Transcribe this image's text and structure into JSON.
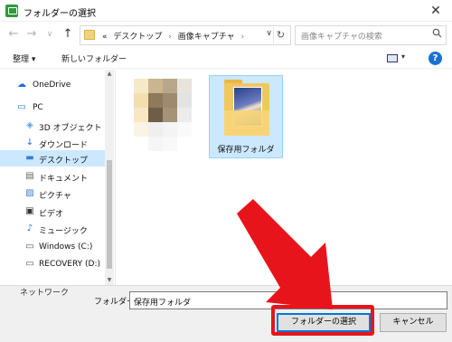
{
  "window": {
    "title": "フォルダーの選択",
    "close_glyph": "✕"
  },
  "nav": {
    "back_glyph": "←",
    "forward_glyph": "→",
    "dropdown_glyph": "∨",
    "up_glyph": "↑",
    "address": {
      "prefix": "«",
      "crumbs": [
        "デスクトップ",
        "画像キャプチャ"
      ],
      "separator": "›",
      "drop_glyph": "∨",
      "refresh_glyph": "↻"
    },
    "search": {
      "placeholder": "画像キャプチャの検索",
      "icon": "search-icon"
    }
  },
  "toolbar": {
    "organize_label": "整理 ▾",
    "new_folder_label": "新しいフォルダー",
    "help_label": "?",
    "view_drop": "▾"
  },
  "sidebar": {
    "items": [
      {
        "label": "OneDrive",
        "icon": "cloud-icon",
        "glyph": "☁",
        "color": "#1c70d1"
      },
      {
        "label": "PC",
        "icon": "computer-icon",
        "glyph": "▭",
        "color": "#1c70d1"
      },
      {
        "label": "3D オブジェクト",
        "icon": "cube-icon",
        "glyph": "◈",
        "color": "#5aa0e0"
      },
      {
        "label": "ダウンロード",
        "icon": "download-icon",
        "glyph": "↓",
        "color": "#1c70d1"
      },
      {
        "label": "デスクトップ",
        "icon": "desktop-icon",
        "glyph": "▬",
        "color": "#3a7fd0",
        "selected": true
      },
      {
        "label": "ドキュメント",
        "icon": "document-icon",
        "glyph": "▤",
        "color": "#666"
      },
      {
        "label": "ピクチャ",
        "icon": "picture-icon",
        "glyph": "▨",
        "color": "#3a7fd0"
      },
      {
        "label": "ビデオ",
        "icon": "video-icon",
        "glyph": "▣",
        "color": "#333"
      },
      {
        "label": "ミュージック",
        "icon": "music-icon",
        "glyph": "♪",
        "color": "#1c70d1"
      },
      {
        "label": "Windows (C:)",
        "icon": "drive-icon",
        "glyph": "▭",
        "color": "#555"
      },
      {
        "label": "RECOVERY (D:)",
        "icon": "drive-icon",
        "glyph": "▭",
        "color": "#555"
      }
    ],
    "partial_item": "ネットワーク"
  },
  "content": {
    "selected_folder": "保存用フォルダ"
  },
  "bottom": {
    "folder_label": "フォルダー:",
    "folder_value": "保存用フォルダ",
    "select_button": "フォルダーの選択",
    "cancel_button": "キャンセル"
  },
  "colors": {
    "selection": "#cce8ff",
    "annotation_red": "#e8141c",
    "primary_border": "#0078d7"
  }
}
